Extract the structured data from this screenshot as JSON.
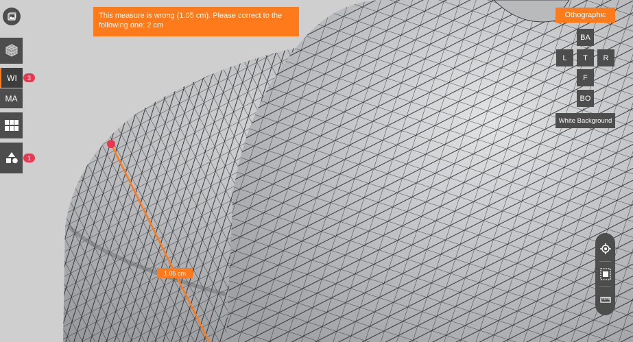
{
  "message": {
    "text": "This measure is wrong (1.05 cm). Please correct to the following one: 2 cm"
  },
  "measurement": {
    "label": "1.05 cm"
  },
  "projection": {
    "label": "Othographic"
  },
  "view_cube": {
    "back": "BA",
    "left": "L",
    "top": "T",
    "right": "R",
    "front": "F",
    "bottom": "BO"
  },
  "background_toggle": {
    "label": "White Background"
  },
  "sidebar": {
    "items": [
      {
        "icon": "gallery-icon"
      },
      {
        "icon": "mesh-cube-icon"
      },
      {
        "label": "WI",
        "badge": "3"
      },
      {
        "label": "MA"
      },
      {
        "icon": "grid-layout-icon"
      },
      {
        "icon": "shapes-icon",
        "badge": "1"
      }
    ]
  },
  "tools": [
    {
      "icon": "locate-icon"
    },
    {
      "icon": "fit-frame-icon"
    },
    {
      "icon": "ruler-icon"
    }
  ],
  "colors": {
    "accent": "#ff7a1a",
    "panel": "#4d4d4d",
    "badge": "#e8384f",
    "mesh": "#c6c7c9"
  }
}
